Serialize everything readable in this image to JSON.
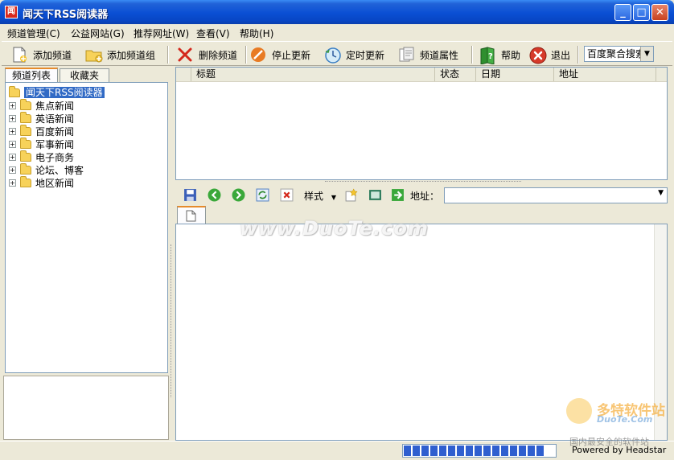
{
  "window": {
    "title": "闻天下RSS阅读器",
    "icon_letter": "闻",
    "controls": [
      "minimize-icon",
      "maximize-icon",
      "close-icon"
    ]
  },
  "menu": {
    "items": [
      "频道管理(C)",
      "公益网站(G)",
      "推荐网址(W)",
      "查看(V)",
      "帮助(H)"
    ]
  },
  "toolbar": {
    "add_channel": "添加频道",
    "add_channel_group": "添加频道组",
    "delete_channel": "删除频道",
    "stop_update": "停止更新",
    "timed_update": "定时更新",
    "channel_properties": "频道属性",
    "help": "帮助",
    "exit": "退出",
    "search_selected": "百度聚合搜索"
  },
  "left_panel": {
    "tabs": [
      "频道列表",
      "收藏夹"
    ],
    "active_tab": "频道列表",
    "root": "闻天下RSS阅读器",
    "folders": [
      "焦点新闻",
      "英语新闻",
      "百度新闻",
      "军事新闻",
      "电子商务",
      "论坛、博客",
      "地区新闻"
    ]
  },
  "article_list": {
    "columns": [
      "标题",
      "状态",
      "日期",
      "地址"
    ]
  },
  "browser_toolbar": {
    "style_label": "样式",
    "address_label": "地址：",
    "address_value": ""
  },
  "status_bar": {
    "progress_blocks": 16,
    "powered_by": "Powered by Headstar"
  },
  "watermarks": {
    "center": "www.DuoTe.com",
    "corner_title": "多特软件站",
    "corner_sub": "DuoTe.Com",
    "corner_note": "国内最安全的软件站"
  },
  "colors": {
    "titlebar": "#0a4fd4",
    "selection": "#316ac5",
    "tab_accent": "#e68b2c",
    "progress": "#2f5fcf"
  }
}
